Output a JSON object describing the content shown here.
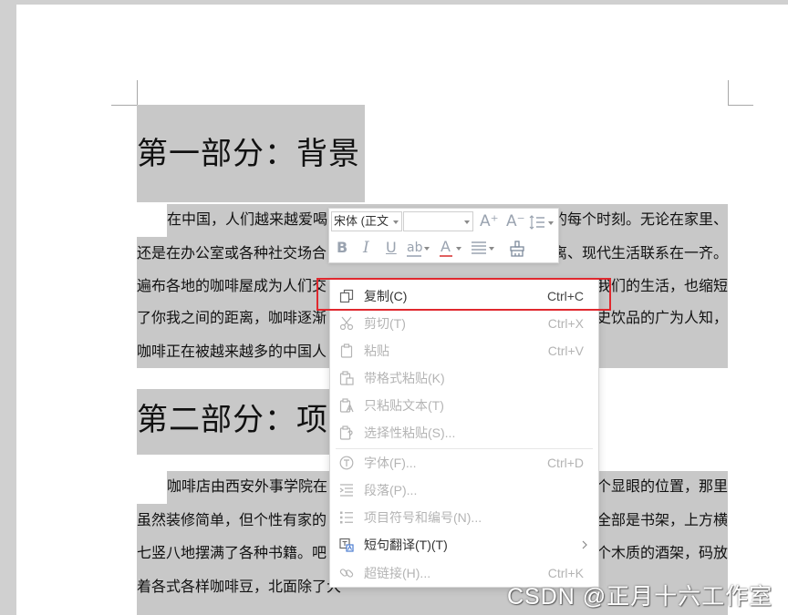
{
  "document": {
    "heading1": "第一部分：背景",
    "paragraph1": [
      {
        "left": "在中国，人们越来越爱喝",
        "right": "的每个时刻。无论在家里、"
      },
      {
        "left": "还是在办公室或各种社交场合",
        "right": "离、现代生活联系在一齐。"
      },
      {
        "left": "遍布各地的咖啡屋成为人们交",
        "right": "我们的生活，也缩短"
      },
      {
        "left": "了你我之间的距离，咖啡逐渐",
        "right": "史饮品的广为人知，"
      },
      {
        "left": "咖啡正在被越来越多的中国人"
      }
    ],
    "heading2": "第二部分：项",
    "paragraph2": [
      {
        "left": "咖啡店由西安外事学院在",
        "right": "个显眼的位置，那里"
      },
      {
        "left": "虽然装修简单，但个性有家的",
        "right": "全部是书架，上方横"
      },
      {
        "left": "七竖八地摆满了各种书籍。吧",
        "right": "个木质的酒架，码放"
      },
      {
        "left": "着各式各样咖啡豆，北面除了大"
      }
    ]
  },
  "mini_toolbar": {
    "font_name": "宋体 (正文",
    "font_size": "",
    "grow_font": "A⁺",
    "shrink_font": "A⁻",
    "bold": "B",
    "italic": "I",
    "underline": "U",
    "highlight": "ab",
    "font_color": "A",
    "icons": [
      "line-spacing-icon",
      "align-icon",
      "format-painter-icon"
    ]
  },
  "context_menu": {
    "items": [
      {
        "label": "复制(C)",
        "shortcut": "Ctrl+C",
        "enabled": true,
        "icon": "copy-icon"
      },
      {
        "label": "剪切(T)",
        "shortcut": "Ctrl+X",
        "enabled": false,
        "icon": "cut-icon"
      },
      {
        "label": "粘贴",
        "shortcut": "Ctrl+V",
        "enabled": false,
        "icon": "paste-icon"
      },
      {
        "label": "带格式粘贴(K)",
        "enabled": false,
        "icon": "paste-with-format-icon"
      },
      {
        "label": "只粘贴文本(T)",
        "enabled": false,
        "icon": "paste-text-only-icon"
      },
      {
        "label": "选择性粘贴(S)...",
        "enabled": false,
        "icon": "paste-special-icon"
      },
      {
        "label": "字体(F)...",
        "shortcut": "Ctrl+D",
        "enabled": false,
        "icon": "font-icon"
      },
      {
        "label": "段落(P)...",
        "enabled": false,
        "icon": "paragraph-icon"
      },
      {
        "label": "项目符号和编号(N)...",
        "enabled": false,
        "icon": "bullets-numbering-icon"
      },
      {
        "label": "短句翻译(T)(T)",
        "enabled": true,
        "submenu": true,
        "icon": "translate-icon"
      },
      {
        "label": "超链接(H)...",
        "shortcut": "Ctrl+K",
        "enabled": false,
        "icon": "hyperlink-icon"
      }
    ]
  },
  "watermark": "CSDN @正月十六工作室",
  "colors": {
    "selection": "#c8c8c8",
    "annotation_box": "#e0282e",
    "menu_text": "#333333",
    "menu_disabled": "#b4b4b4",
    "page_gutter": "#d0d0d0"
  }
}
